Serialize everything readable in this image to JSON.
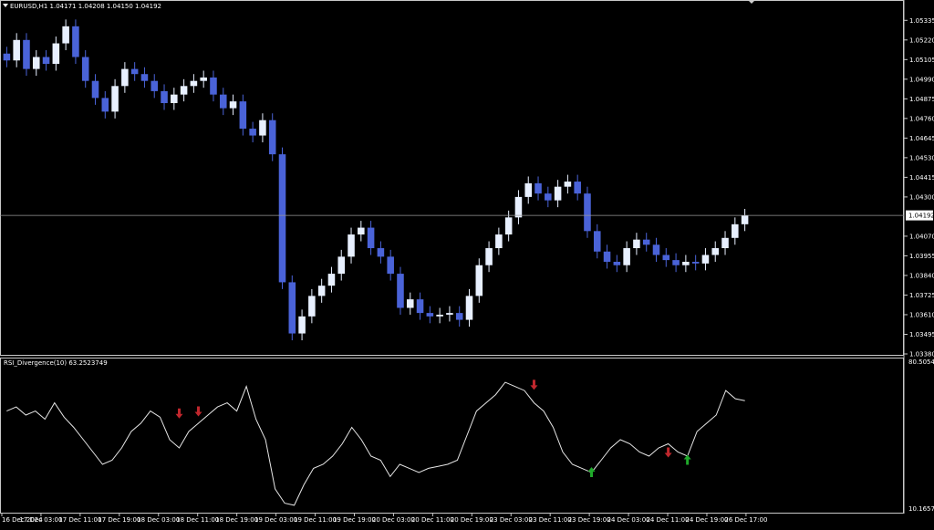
{
  "main_chart": {
    "header": "EURUSD,H1  1.04171 1.04208 1.04150 1.04192",
    "current_price_label": "1.04192",
    "price_ticks": [
      "1.05335",
      "1.05220",
      "1.05105",
      "1.04990",
      "1.04875",
      "1.04760",
      "1.04645",
      "1.04530",
      "1.04415",
      "1.04300",
      "1.04070",
      "1.03955",
      "1.03840",
      "1.03725",
      "1.03610",
      "1.03495",
      "1.03380"
    ]
  },
  "indicator": {
    "header": "RSI_Divergence(10) 63.2523749",
    "max_label": "80.505418",
    "min_label": "10.165795"
  },
  "time_axis": {
    "labels": [
      "16 Dec 2024",
      "17 Dec 03:00",
      "17 Dec 11:00",
      "17 Dec 19:00",
      "18 Dec 03:00",
      "18 Dec 11:00",
      "18 Dec 19:00",
      "19 Dec 03:00",
      "19 Dec 11:00",
      "19 Dec 19:00",
      "20 Dec 03:00",
      "20 Dec 11:00",
      "20 Dec 19:00",
      "23 Dec 03:00",
      "23 Dec 11:00",
      "23 Dec 19:00",
      "24 Dec 03:00",
      "24 Dec 11:00",
      "24 Dec 19:00",
      "26 Dec 17:00"
    ]
  },
  "chart_data": [
    {
      "type": "candlestick",
      "symbol": "EURUSD",
      "timeframe": "H1",
      "ylim": [
        1.0338,
        1.0539
      ],
      "current_price": 1.04192,
      "bull_color": "#e8f0ff",
      "bear_color": "#4a63d8",
      "close_series": [
        1.051,
        1.0522,
        1.0505,
        1.0512,
        1.0508,
        1.052,
        1.053,
        1.0512,
        1.0498,
        1.0488,
        1.048,
        1.0495,
        1.0505,
        1.0502,
        1.0498,
        1.0492,
        1.0485,
        1.049,
        1.0495,
        1.0498,
        1.05,
        1.049,
        1.0482,
        1.0486,
        1.047,
        1.0466,
        1.0475,
        1.0455,
        1.038,
        1.035,
        1.036,
        1.0372,
        1.0378,
        1.0385,
        1.0395,
        1.0408,
        1.0412,
        1.04,
        1.0395,
        1.0385,
        1.0365,
        1.037,
        1.0362,
        1.036,
        1.0361,
        1.0362,
        1.0358,
        1.0372,
        1.039,
        1.04,
        1.0408,
        1.0418,
        1.043,
        1.0438,
        1.0432,
        1.0428,
        1.0436,
        1.0439,
        1.0432,
        1.041,
        1.0398,
        1.0392,
        1.039,
        1.04,
        1.0405,
        1.0402,
        1.0396,
        1.0393,
        1.039,
        1.0392,
        1.0391,
        1.0396,
        1.04,
        1.0406,
        1.0414,
        1.0419
      ],
      "hline": 1.04192
    },
    {
      "type": "line",
      "name": "RSI_Divergence(10)",
      "ylim": [
        10.165795,
        80.505418
      ],
      "last_value": 63.2523749,
      "values": [
        58,
        60,
        56,
        58,
        54,
        62,
        55,
        50,
        44,
        38,
        32,
        34,
        40,
        48,
        52,
        58,
        55,
        44,
        40,
        48,
        52,
        56,
        60,
        62,
        58,
        70,
        54,
        44,
        20,
        13,
        12,
        22,
        30,
        32,
        36,
        42,
        50,
        44,
        36,
        34,
        26,
        32,
        30,
        28,
        30,
        31,
        32,
        34,
        46,
        58,
        62,
        66,
        72,
        70,
        68,
        62,
        58,
        50,
        38,
        32,
        30,
        28,
        34,
        40,
        44,
        42,
        38,
        36,
        40,
        42,
        38,
        36,
        48,
        52,
        56,
        68,
        64,
        63
      ],
      "bull_markers": [
        [
          61,
          28
        ],
        [
          71,
          34
        ]
      ],
      "bear_markers": [
        [
          18,
          57
        ],
        [
          20,
          58
        ],
        [
          55,
          71
        ],
        [
          69,
          38
        ]
      ]
    }
  ]
}
